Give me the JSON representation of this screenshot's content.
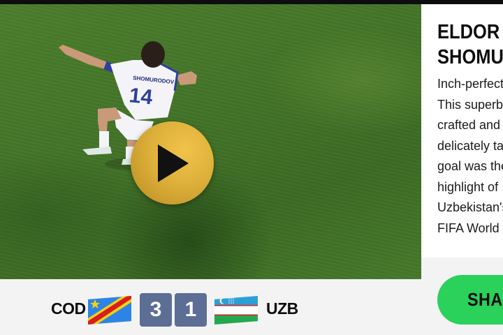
{
  "video": {
    "player_name_on_shirt": "SHOMURODOV",
    "player_number": "14",
    "play_icon": "play-icon"
  },
  "match": {
    "home": {
      "code": "COD",
      "score": "3",
      "flag": "flag-dr-congo"
    },
    "away": {
      "code": "UZB",
      "score": "1",
      "flag": "flag-uzbekistan"
    }
  },
  "panel": {
    "title_line1": "ELDOR",
    "title_line2": "SHOMURODOV",
    "description_lines": [
      "Inch-perfect.",
      "This superb pass was",
      "crafted and",
      "delicately taken. This",
      "goal was the",
      "highlight of",
      "Uzbekistan's",
      "FIFA World Cup."
    ],
    "share_label": "SHARE"
  },
  "colors": {
    "play_gold": "#ddb03a",
    "score_box": "#5c6e96",
    "share_green": "#2ad15b"
  }
}
